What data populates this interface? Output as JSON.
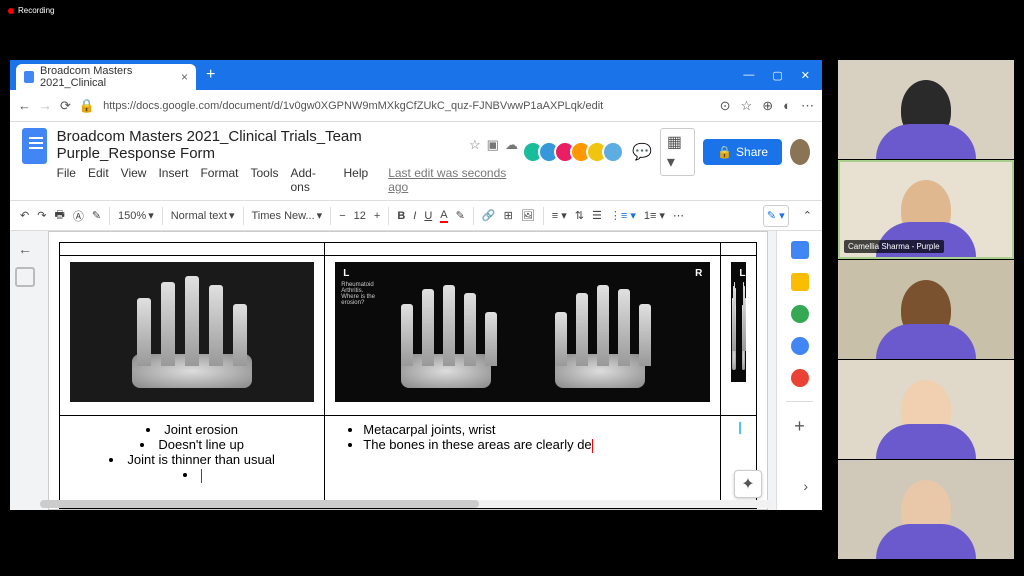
{
  "recording_label": "Recording",
  "browser": {
    "tab_title": "Broadcom Masters 2021_Clinical",
    "url": "https://docs.google.com/document/d/1v0gw0XGPNW9mMXkgCfZUkC_quz-FJNBVwwP1aAXPLqk/edit"
  },
  "docs": {
    "title": "Broadcom Masters 2021_Clinical Trials_Team Purple_Response Form",
    "menus": [
      "File",
      "Edit",
      "View",
      "Insert",
      "Format",
      "Tools",
      "Add-ons",
      "Help"
    ],
    "last_edit": "Last edit was seconds ago",
    "share_label": "Share",
    "collab_colors": [
      "#1abc9c",
      "#3498db",
      "#e91e63",
      "#ff9800",
      "#f1c40f",
      "#5dade2"
    ]
  },
  "toolbar": {
    "zoom": "150%",
    "style": "Normal text",
    "font": "Times New...",
    "size": "12"
  },
  "document": {
    "xray2_label_l": "L",
    "xray2_label_r": "R",
    "xray2_text": "Rheumatoid Arthritis. Where is the erosion?",
    "xray3_label": "L",
    "col1_bullets": [
      "Joint erosion",
      "Doesn't line up",
      "Joint is thinner than usual"
    ],
    "col2_bullets": [
      "Metacarpal joints, wrist",
      "The bones in these areas are clearly de"
    ]
  },
  "sidebar": {
    "icon_colors": [
      "#fbbc04",
      "#fbbc04",
      "#34a853"
    ]
  },
  "video": {
    "active_name": "Camellia Sharma - Purple",
    "skin": [
      "#e8c8a0",
      "#e0b890",
      "#7a5230",
      "#f0d0b0",
      "#e8c8a8"
    ],
    "bg": [
      "#d8d0c0",
      "#e8e0d0",
      "#c8c0a8",
      "#e0d8c8",
      "#d0c8b8"
    ]
  }
}
